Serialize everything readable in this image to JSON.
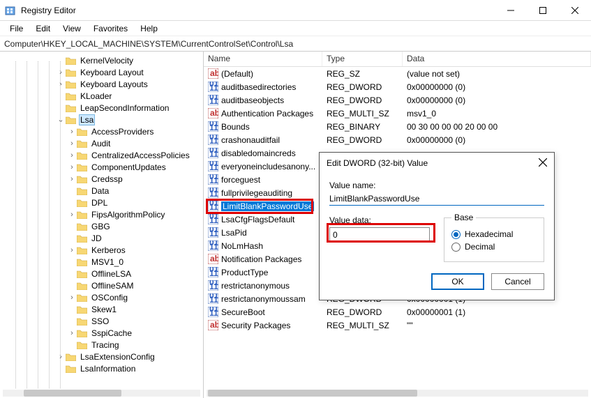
{
  "window": {
    "title": "Registry Editor",
    "minimize": "−",
    "maximize": "▢",
    "close": "✕"
  },
  "menu": {
    "file": "File",
    "edit": "Edit",
    "view": "View",
    "favorites": "Favorites",
    "help": "Help"
  },
  "address": "Computer\\HKEY_LOCAL_MACHINE\\SYSTEM\\CurrentControlSet\\Control\\Lsa",
  "tree": {
    "items": [
      {
        "indent": 5,
        "twisty": "",
        "label": "KernelVelocity"
      },
      {
        "indent": 5,
        "twisty": ">",
        "label": "Keyboard Layout"
      },
      {
        "indent": 5,
        "twisty": ">",
        "label": "Keyboard Layouts"
      },
      {
        "indent": 5,
        "twisty": "",
        "label": "KLoader"
      },
      {
        "indent": 5,
        "twisty": "",
        "label": "LeapSecondInformation"
      },
      {
        "indent": 5,
        "twisty": "v",
        "label": "Lsa",
        "selected": true
      },
      {
        "indent": 6,
        "twisty": ">",
        "label": "AccessProviders"
      },
      {
        "indent": 6,
        "twisty": ">",
        "label": "Audit"
      },
      {
        "indent": 6,
        "twisty": ">",
        "label": "CentralizedAccessPolicies"
      },
      {
        "indent": 6,
        "twisty": ">",
        "label": "ComponentUpdates"
      },
      {
        "indent": 6,
        "twisty": ">",
        "label": "Credssp"
      },
      {
        "indent": 6,
        "twisty": "",
        "label": "Data"
      },
      {
        "indent": 6,
        "twisty": "",
        "label": "DPL"
      },
      {
        "indent": 6,
        "twisty": ">",
        "label": "FipsAlgorithmPolicy"
      },
      {
        "indent": 6,
        "twisty": "",
        "label": "GBG"
      },
      {
        "indent": 6,
        "twisty": "",
        "label": "JD"
      },
      {
        "indent": 6,
        "twisty": ">",
        "label": "Kerberos"
      },
      {
        "indent": 6,
        "twisty": "",
        "label": "MSV1_0"
      },
      {
        "indent": 6,
        "twisty": "",
        "label": "OfflineLSA"
      },
      {
        "indent": 6,
        "twisty": "",
        "label": "OfflineSAM"
      },
      {
        "indent": 6,
        "twisty": ">",
        "label": "OSConfig"
      },
      {
        "indent": 6,
        "twisty": "",
        "label": "Skew1"
      },
      {
        "indent": 6,
        "twisty": "",
        "label": "SSO"
      },
      {
        "indent": 6,
        "twisty": ">",
        "label": "SspiCache"
      },
      {
        "indent": 6,
        "twisty": "",
        "label": "Tracing"
      },
      {
        "indent": 5,
        "twisty": ">",
        "label": "LsaExtensionConfig"
      },
      {
        "indent": 5,
        "twisty": "",
        "label": "LsaInformation"
      }
    ]
  },
  "list": {
    "columns": {
      "name": "Name",
      "type": "Type",
      "data": "Data"
    },
    "rows": [
      {
        "icon": "string",
        "name": "(Default)",
        "type": "REG_SZ",
        "data": "(value not set)"
      },
      {
        "icon": "binary",
        "name": "auditbasedirectories",
        "type": "REG_DWORD",
        "data": "0x00000000 (0)"
      },
      {
        "icon": "binary",
        "name": "auditbaseobjects",
        "type": "REG_DWORD",
        "data": "0x00000000 (0)"
      },
      {
        "icon": "string",
        "name": "Authentication Packages",
        "type": "REG_MULTI_SZ",
        "data": "msv1_0"
      },
      {
        "icon": "binary",
        "name": "Bounds",
        "type": "REG_BINARY",
        "data": "00 30 00 00 00 20 00 00"
      },
      {
        "icon": "binary",
        "name": "crashonauditfail",
        "type": "REG_DWORD",
        "data": "0x00000000 (0)"
      },
      {
        "icon": "binary",
        "name": "disabledomaincreds",
        "type": "",
        "data": ""
      },
      {
        "icon": "binary",
        "name": "everyoneincludesanony...",
        "type": "",
        "data": ""
      },
      {
        "icon": "binary",
        "name": "forceguest",
        "type": "",
        "data": ""
      },
      {
        "icon": "binary",
        "name": "fullprivilegeauditing",
        "type": "",
        "data": ""
      },
      {
        "icon": "binary",
        "name": "LimitBlankPasswordUse",
        "type": "",
        "data": "",
        "selected": true
      },
      {
        "icon": "binary",
        "name": "LsaCfgFlagsDefault",
        "type": "",
        "data": ""
      },
      {
        "icon": "binary",
        "name": "LsaPid",
        "type": "",
        "data": ""
      },
      {
        "icon": "binary",
        "name": "NoLmHash",
        "type": "",
        "data": ""
      },
      {
        "icon": "string",
        "name": "Notification Packages",
        "type": "",
        "data": ""
      },
      {
        "icon": "binary",
        "name": "ProductType",
        "type": "",
        "data": ""
      },
      {
        "icon": "binary",
        "name": "restrictanonymous",
        "type": "",
        "data": ""
      },
      {
        "icon": "binary",
        "name": "restrictanonymoussam",
        "type": "REG_DWORD",
        "data": "0x00000001 (1)"
      },
      {
        "icon": "binary",
        "name": "SecureBoot",
        "type": "REG_DWORD",
        "data": "0x00000001 (1)"
      },
      {
        "icon": "string",
        "name": "Security Packages",
        "type": "REG_MULTI_SZ",
        "data": "\"\""
      }
    ]
  },
  "dialog": {
    "title": "Edit DWORD (32-bit) Value",
    "value_name_label": "Value name:",
    "value_name": "LimitBlankPasswordUse",
    "value_data_label": "Value data:",
    "value_data": "0",
    "base_label": "Base",
    "hex": "Hexadecimal",
    "dec": "Decimal",
    "ok": "OK",
    "cancel": "Cancel"
  },
  "colors": {
    "selection_bg": "#0078d7",
    "highlight_red": "#d00000",
    "accent": "#0067c0"
  }
}
